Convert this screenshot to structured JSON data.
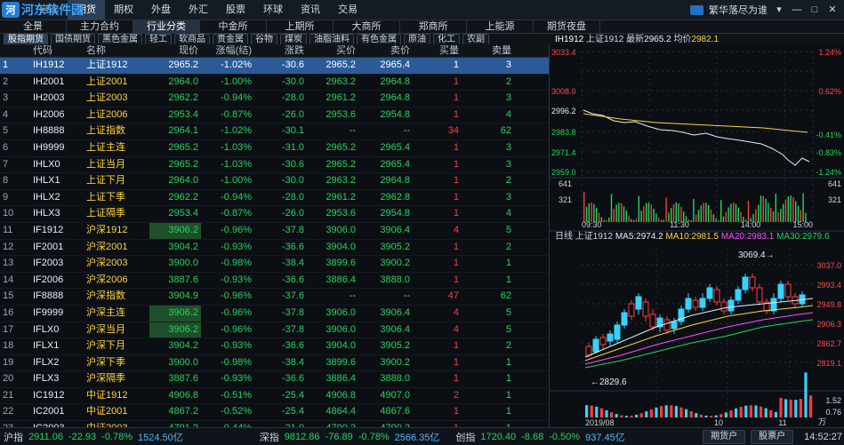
{
  "top_menu": {
    "items": [
      "自选",
      "期货",
      "期权",
      "外盘",
      "外汇",
      "股票",
      "环球",
      "资讯",
      "交易"
    ],
    "active_index": 1
  },
  "brand": {
    "logo_text": "河东软件园",
    "logo_sub": "www.pc0359.cn"
  },
  "top_right": {
    "account": "繁华落尽为谁"
  },
  "tabs_row1": {
    "items": [
      "全景",
      "主力合约",
      "行业分类",
      "中金所",
      "上期所",
      "大商所",
      "郑商所",
      "上能源",
      "期货夜盘"
    ],
    "active_index": 2
  },
  "chips": {
    "items": [
      "股指期货",
      "国债期货",
      "黑色金属",
      "轻工",
      "软商品",
      "贵金属",
      "谷物",
      "煤炭",
      "油脂油料",
      "有色金属",
      "原油",
      "化工",
      "农副"
    ],
    "active_index": 0
  },
  "table": {
    "columns": [
      "",
      "代码",
      "名称",
      "现价",
      "涨幅(结)",
      "涨跌",
      "买价",
      "卖价",
      "买量",
      "卖量"
    ],
    "rows": [
      {
        "idx": "1",
        "code": "IH1912",
        "name": "上证1912",
        "price": "2965.2",
        "pct": "-1.02%",
        "chg": "-30.6",
        "bid": "2965.2",
        "ask": "2965.4",
        "bidv": "1",
        "askv": "3",
        "selected": true
      },
      {
        "idx": "2",
        "code": "IH2001",
        "name": "上证2001",
        "price": "2964.0",
        "pct": "-1.00%",
        "chg": "-30.0",
        "bid": "2963.2",
        "ask": "2964.8",
        "bidv": "1",
        "askv": "2"
      },
      {
        "idx": "3",
        "code": "IH2003",
        "name": "上证2003",
        "price": "2962.2",
        "pct": "-0.94%",
        "chg": "-28.0",
        "bid": "2961.2",
        "ask": "2964.8",
        "bidv": "1",
        "askv": "3"
      },
      {
        "idx": "4",
        "code": "IH2006",
        "name": "上证2006",
        "price": "2953.4",
        "pct": "-0.87%",
        "chg": "-26.0",
        "bid": "2953.6",
        "ask": "2954.8",
        "bidv": "1",
        "askv": "4"
      },
      {
        "idx": "5",
        "code": "IH8888",
        "name": "上证指数",
        "price": "2964.1",
        "pct": "-1.02%",
        "chg": "-30.1",
        "bid": "--",
        "ask": "--",
        "bidv": "34",
        "askv": "62"
      },
      {
        "idx": "6",
        "code": "IH9999",
        "name": "上证主连",
        "price": "2965.2",
        "pct": "-1.03%",
        "chg": "-31.0",
        "bid": "2965.2",
        "ask": "2965.4",
        "bidv": "1",
        "askv": "3"
      },
      {
        "idx": "7",
        "code": "IHLX0",
        "name": "上证当月",
        "price": "2965.2",
        "pct": "-1.03%",
        "chg": "-30.6",
        "bid": "2965.2",
        "ask": "2965.4",
        "bidv": "1",
        "askv": "3"
      },
      {
        "idx": "8",
        "code": "IHLX1",
        "name": "上证下月",
        "price": "2964.0",
        "pct": "-1.00%",
        "chg": "-30.0",
        "bid": "2963.2",
        "ask": "2964.8",
        "bidv": "1",
        "askv": "2"
      },
      {
        "idx": "9",
        "code": "IHLX2",
        "name": "上证下季",
        "price": "2962.2",
        "pct": "-0.94%",
        "chg": "-28.0",
        "bid": "2961.2",
        "ask": "2962.8",
        "bidv": "1",
        "askv": "3"
      },
      {
        "idx": "10",
        "code": "IHLX3",
        "name": "上证隔季",
        "price": "2953.4",
        "pct": "-0.87%",
        "chg": "-26.0",
        "bid": "2953.6",
        "ask": "2954.8",
        "bidv": "1",
        "askv": "4"
      },
      {
        "idx": "11",
        "code": "IF1912",
        "name": "沪深1912",
        "price": "3906.2",
        "pct": "-0.96%",
        "chg": "-37.8",
        "bid": "3906.0",
        "ask": "3906.4",
        "bidv": "4",
        "askv": "5",
        "price_hl": true
      },
      {
        "idx": "12",
        "code": "IF2001",
        "name": "沪深2001",
        "price": "3904.2",
        "pct": "-0.93%",
        "chg": "-36.6",
        "bid": "3904.0",
        "ask": "3905.2",
        "bidv": "1",
        "askv": "2"
      },
      {
        "idx": "13",
        "code": "IF2003",
        "name": "沪深2003",
        "price": "3900.0",
        "pct": "-0.98%",
        "chg": "-38.4",
        "bid": "3899.6",
        "ask": "3900.2",
        "bidv": "1",
        "askv": "1"
      },
      {
        "idx": "14",
        "code": "IF2006",
        "name": "沪深2006",
        "price": "3887.6",
        "pct": "-0.93%",
        "chg": "-36.6",
        "bid": "3886.4",
        "ask": "3888.0",
        "bidv": "1",
        "askv": "1"
      },
      {
        "idx": "15",
        "code": "IF8888",
        "name": "沪深指数",
        "price": "3904.9",
        "pct": "-0.96%",
        "chg": "-37.6",
        "bid": "--",
        "ask": "--",
        "bidv": "47",
        "askv": "62"
      },
      {
        "idx": "16",
        "code": "IF9999",
        "name": "沪深主连",
        "price": "3906.2",
        "pct": "-0.96%",
        "chg": "-37.8",
        "bid": "3906.0",
        "ask": "3906.4",
        "bidv": "4",
        "askv": "5",
        "price_hl": true
      },
      {
        "idx": "17",
        "code": "IFLX0",
        "name": "沪深当月",
        "price": "3906.2",
        "pct": "-0.96%",
        "chg": "-37.8",
        "bid": "3906.0",
        "ask": "3906.4",
        "bidv": "4",
        "askv": "5",
        "price_hl": true
      },
      {
        "idx": "18",
        "code": "IFLX1",
        "name": "沪深下月",
        "price": "3904.2",
        "pct": "-0.93%",
        "chg": "-36.6",
        "bid": "3904.0",
        "ask": "3905.2",
        "bidv": "1",
        "askv": "2"
      },
      {
        "idx": "19",
        "code": "IFLX2",
        "name": "沪深下季",
        "price": "3900.0",
        "pct": "-0.98%",
        "chg": "-38.4",
        "bid": "3899.6",
        "ask": "3900.2",
        "bidv": "1",
        "askv": "1"
      },
      {
        "idx": "20",
        "code": "IFLX3",
        "name": "沪深隔季",
        "price": "3887.6",
        "pct": "-0.93%",
        "chg": "-36.6",
        "bid": "3886.4",
        "ask": "3888.0",
        "bidv": "1",
        "askv": "1"
      },
      {
        "idx": "21",
        "code": "IC1912",
        "name": "中证1912",
        "price": "4906.8",
        "pct": "-0.51%",
        "chg": "-25.4",
        "bid": "4906.8",
        "ask": "4907.0",
        "bidv": "2",
        "askv": "1"
      },
      {
        "idx": "22",
        "code": "IC2001",
        "name": "中证2001",
        "price": "4867.2",
        "pct": "-0.52%",
        "chg": "-25.4",
        "bid": "4864.4",
        "ask": "4867.6",
        "bidv": "1",
        "askv": "1"
      },
      {
        "idx": "23",
        "code": "IC2003",
        "name": "中证2003",
        "price": "4791.2",
        "pct": "-0.44%",
        "chg": "-21.0",
        "bid": "4790.2",
        "ask": "4790.2",
        "bidv": "1",
        "askv": "1"
      }
    ]
  },
  "intraday": {
    "header": {
      "symbol": "上证1912",
      "code": "IH1912",
      "latest_label": "最新",
      "latest": "2965.2",
      "avg_label": "均价",
      "avg": "2982.1"
    },
    "y_left_labels": [
      "3033.4",
      "3008.0",
      "2996.2",
      "2983.8",
      "2971.4",
      "2959.0"
    ],
    "y_right_labels": [
      "1.24%",
      "0.62%",
      "-0.41%",
      "-0.83%",
      "-1.24%"
    ],
    "vol_left_labels": [
      "641",
      "321"
    ],
    "vol_right_labels": [
      "641",
      "321"
    ],
    "x_labels": [
      "09:30",
      "11:30",
      "14:00",
      "15:00"
    ]
  },
  "kline": {
    "header": {
      "period": "日线",
      "symbol": "上证1912",
      "ma5_label": "MA5:",
      "ma5": "2974.2",
      "ma10_label": "MA10:",
      "ma10": "2981.5",
      "ma20_label": "MA20:",
      "ma20": "2983.1",
      "ma30_label": "MA30:",
      "ma30": "2979.6"
    },
    "y_right_labels": [
      "3037.0",
      "2993.4",
      "2949.8",
      "2906.3",
      "2862.7",
      "2819.1"
    ],
    "annotations": {
      "high_label": "3069.4",
      "low_label": "2829.6"
    },
    "vol_right_labels": [
      "1.52",
      "0.76"
    ],
    "vol_unit": "万",
    "x_labels": [
      "2019/08",
      "10",
      "11"
    ]
  },
  "status": {
    "sh_label": "沪指",
    "sh_val": "2911.06",
    "sh_chg": "-22.93",
    "sh_pct": "-0.78%",
    "sh_amt": "1524.50亿",
    "sz_label": "深指",
    "sz_val": "9812.86",
    "sz_chg": "-76.89",
    "sz_pct": "-0.78%",
    "sz_amt": "2566.35亿",
    "cy_label": "创指",
    "cy_val": "1720.40",
    "cy_chg": "-8.68",
    "cy_pct": "-0.50%",
    "cy_amt": "937.45亿",
    "btn_open_label": "期货户",
    "btn_stock_label": "股票户",
    "time": "14:52:27"
  }
}
